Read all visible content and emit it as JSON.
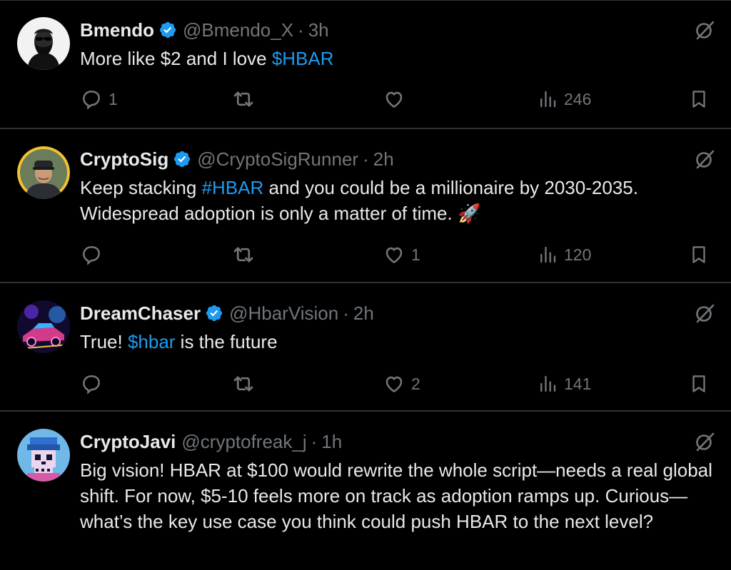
{
  "colors": {
    "background": "#000000",
    "text": "#e7e9ea",
    "secondary": "#71767b",
    "link": "#1d9bf0",
    "verified": "#1d9bf0",
    "divider": "#2f3336"
  },
  "tweets": [
    {
      "name": "Bmendo",
      "verified": true,
      "handle": "@Bmendo_X",
      "separator": "·",
      "time": "3h",
      "text_parts": [
        {
          "text": "More like $2 and I love "
        },
        {
          "text": "$HBAR",
          "link": true
        }
      ],
      "replies": "1",
      "reposts": "",
      "likes": "",
      "views": "246",
      "avatar_icon": "bearded-man-avatar"
    },
    {
      "name": "CryptoSig",
      "verified": true,
      "handle": "@CryptoSigRunner",
      "separator": "·",
      "time": "2h",
      "text_parts": [
        {
          "text": "Keep stacking "
        },
        {
          "text": "#HBAR",
          "link": true
        },
        {
          "text": " and you could be a millionaire by 2030-2035. Widespread adoption is only a matter of time. "
        },
        {
          "text": "🚀",
          "emoji": "rocket"
        }
      ],
      "replies": "",
      "reposts": "",
      "likes": "1",
      "views": "120",
      "avatar_icon": "man-in-cap-avatar"
    },
    {
      "name": "DreamChaser",
      "verified": true,
      "handle": "@HbarVision",
      "separator": "·",
      "time": "2h",
      "text_parts": [
        {
          "text": "True! "
        },
        {
          "text": "$hbar",
          "link": true
        },
        {
          "text": " is the future"
        }
      ],
      "replies": "",
      "reposts": "",
      "likes": "2",
      "views": "141",
      "avatar_icon": "neon-car-avatar"
    },
    {
      "name": "CryptoJavi",
      "verified": false,
      "handle": "@cryptofreak_j",
      "separator": "·",
      "time": "1h",
      "text_parts": [
        {
          "text": "Big vision! HBAR at $100 would rewrite the whole script—needs a real global shift. For now, $5-10 feels more on track as adoption ramps up. Curious—what’s the key use case you think could push HBAR to the next level?"
        }
      ],
      "avatar_icon": "pixel-skull-avatar"
    }
  ]
}
